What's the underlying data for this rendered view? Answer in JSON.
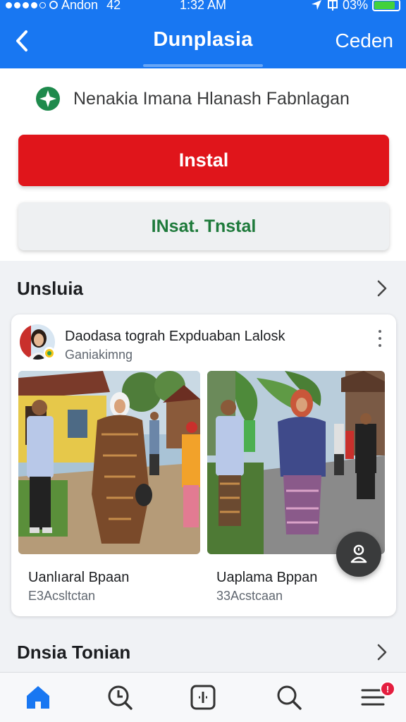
{
  "status_bar": {
    "carrier": "Andon",
    "signal_text": "42",
    "time": "1:32 AM",
    "battery": "03%"
  },
  "nav": {
    "back_icon": "chevron-left-icon",
    "title": "Dunplasia",
    "right_label": "Ceden"
  },
  "app": {
    "icon": "green-star-icon",
    "name": "Nenakia Imana Hlanash Fabnlagan",
    "primary_button": "Instal",
    "secondary_button": "INsat. Tnstal"
  },
  "section1": {
    "title": "Unsluia"
  },
  "post": {
    "title": "Daodasa tograh Expduaban Lalosk",
    "subtitle": "Ganiakimng",
    "photos": [
      {
        "caption": "Uanlıaral Bpaan",
        "subcaption": "E3Acsltctan"
      },
      {
        "caption": "Uaplama Bppan",
        "subcaption": "33Acstcaan"
      }
    ]
  },
  "section2": {
    "title": "Dnsia Tonian"
  },
  "bottom_nav": {
    "items": [
      "home-icon",
      "clock-search-icon",
      "add-square-icon",
      "search-icon",
      "menu-icon"
    ],
    "menu_badge": "!"
  },
  "colors": {
    "header": "#1877f2",
    "primary_button": "#e0151b",
    "secondary_text": "#1e7a3b",
    "home_active": "#1877f2"
  }
}
